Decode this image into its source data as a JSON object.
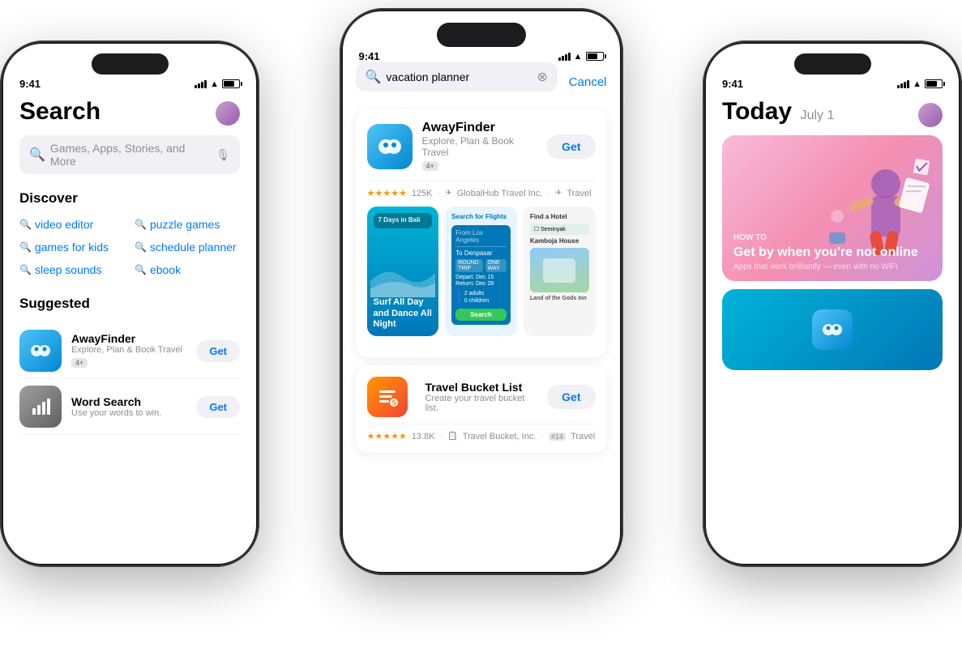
{
  "phones": {
    "left": {
      "time": "9:41",
      "title": "Search",
      "search_placeholder": "Games, Apps, Stories, and More",
      "discover_label": "Discover",
      "discover_items": [
        "video editor",
        "puzzle games",
        "games for kids",
        "schedule planner",
        "sleep sounds",
        "ebook"
      ],
      "suggested_label": "Suggested",
      "apps": [
        {
          "name": "AwayFinder",
          "desc": "Explore, Plan & Book Travel",
          "badge": "4+",
          "btn": "Get"
        },
        {
          "name": "Word Search",
          "desc": "Use your words to win.",
          "btn": "Get"
        }
      ]
    },
    "center": {
      "time": "9:41",
      "search_value": "vacation planner",
      "cancel_label": "Cancel",
      "app1": {
        "name": "AwayFinder",
        "desc": "Explore, Plan & Book Travel",
        "badge": "4+",
        "btn": "Get",
        "rating": "★★★★★",
        "reviews": "125K",
        "publisher": "GlobalHub Travel Inc.",
        "category": "Travel"
      },
      "screenshot_labels": [
        "7 Days in Bali",
        "Search for Flights",
        "Find a Hotel"
      ],
      "sc_title": "Surf All Day and Dance All Night",
      "app2": {
        "name": "Travel Bucket List",
        "desc": "Create your travel bucket list.",
        "btn": "Get",
        "rating": "★★★★★",
        "reviews": "13.8K",
        "publisher": "Travel Bucket, Inc.",
        "badge": "#14",
        "category": "Travel"
      }
    },
    "right": {
      "time": "9:41",
      "title": "Today",
      "date": "July 1",
      "card1": {
        "label": "HOW TO",
        "headline": "Get by when you're not online",
        "sub": "Apps that work brilliantly — even with no WiFi"
      }
    }
  }
}
